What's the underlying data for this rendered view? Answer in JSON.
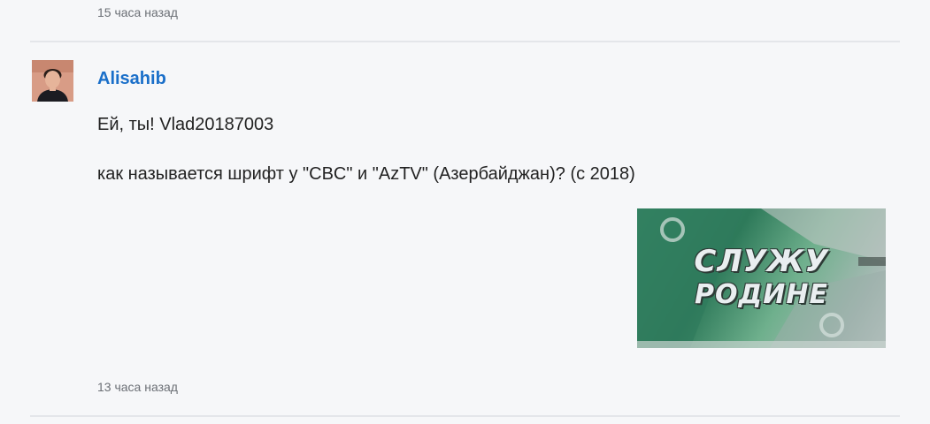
{
  "previous_comment": {
    "timestamp": "15 часа назад"
  },
  "comment": {
    "author": "Alisahib",
    "lines": [
      "Ей, ты! Vlad20187003",
      "как называется шрифт у \"CBC\" и \"AzTV\" (Азербайджан)? (с 2018)"
    ],
    "attachment": {
      "title_line_1": "СЛУЖУ",
      "title_line_2": "РОДИНЕ"
    },
    "timestamp": "13 часа назад"
  }
}
